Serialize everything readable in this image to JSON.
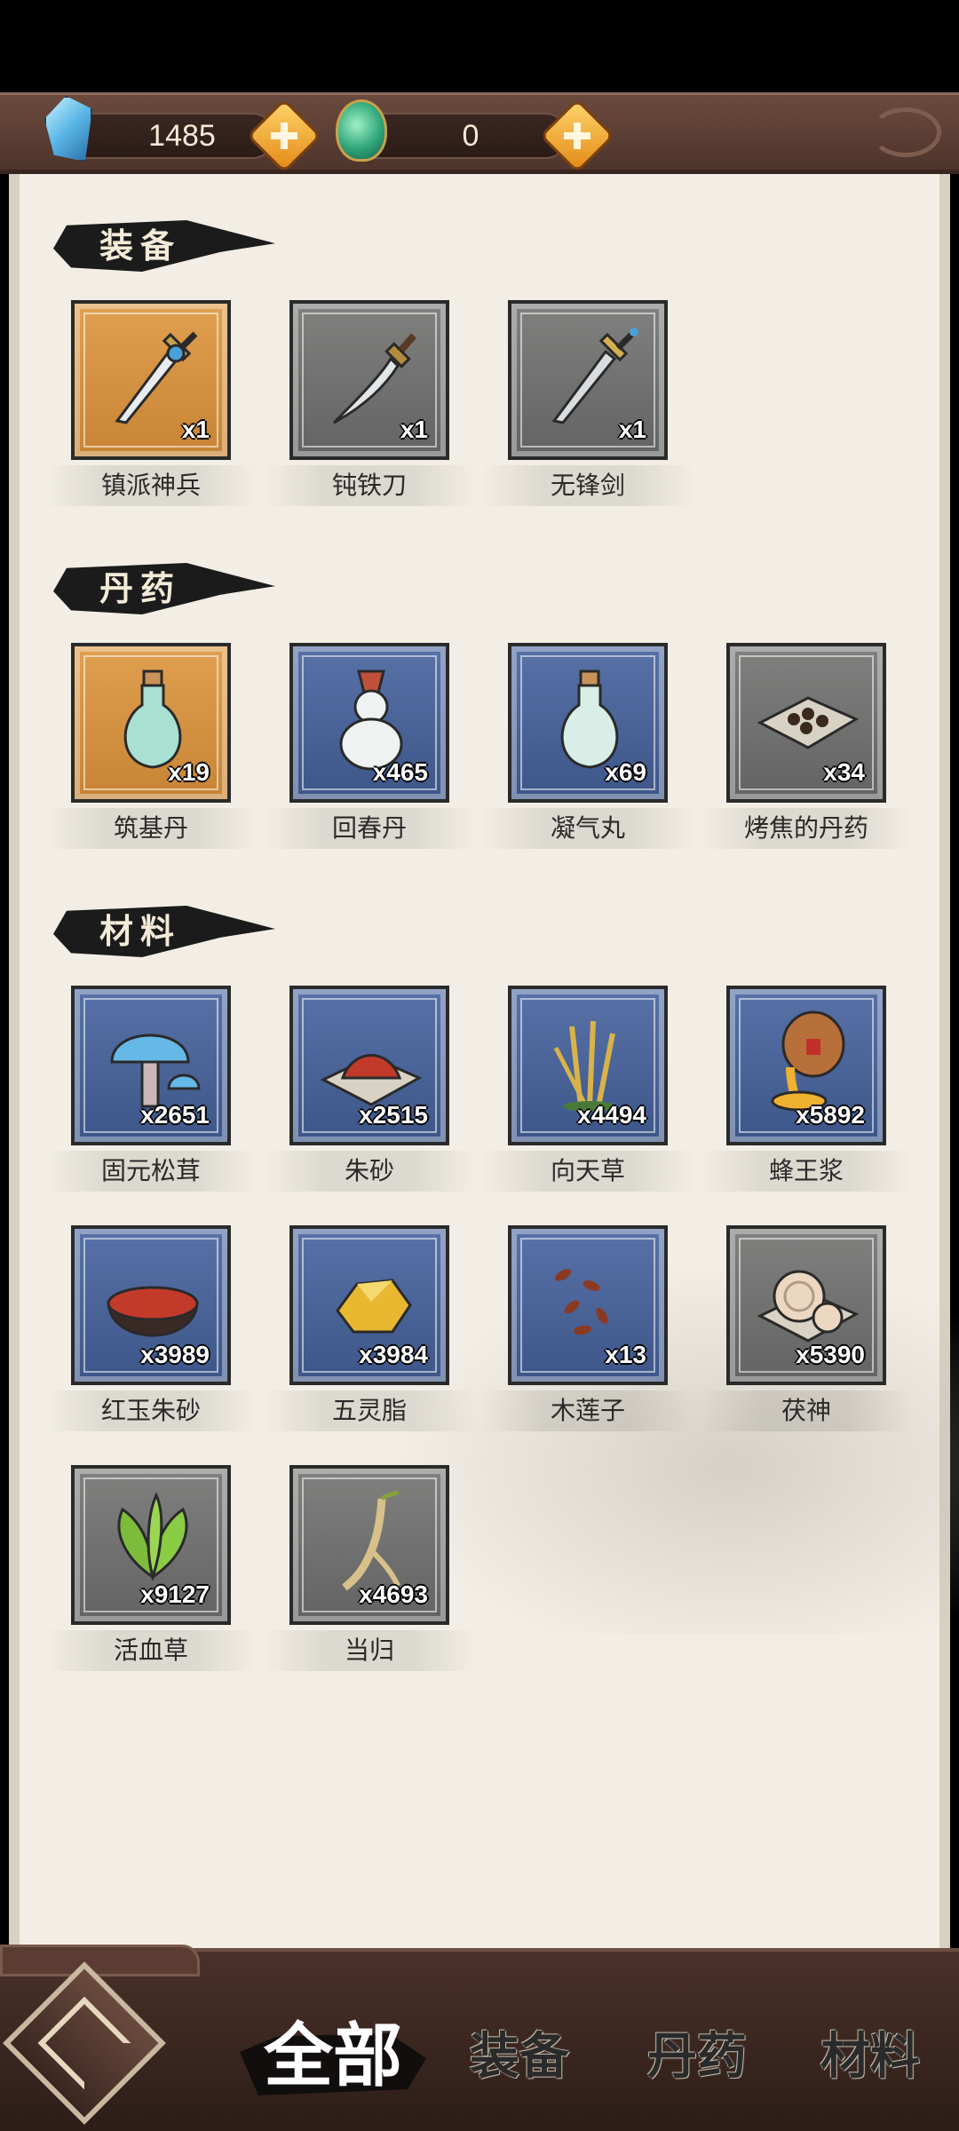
{
  "currency": {
    "crystals": "1485",
    "jade": "0"
  },
  "sections": [
    {
      "title": "装备",
      "items": [
        {
          "name": "镇派神兵",
          "qty": "x1",
          "rarity": "gold",
          "icon": "sword-icon"
        },
        {
          "name": "钝铁刀",
          "qty": "x1",
          "rarity": "gray",
          "icon": "saber-icon"
        },
        {
          "name": "无锋剑",
          "qty": "x1",
          "rarity": "gray",
          "icon": "sword-icon"
        }
      ]
    },
    {
      "title": "丹药",
      "items": [
        {
          "name": "筑基丹",
          "qty": "x19",
          "rarity": "gold",
          "icon": "potion-bottle-icon"
        },
        {
          "name": "回春丹",
          "qty": "x465",
          "rarity": "blue",
          "icon": "gourd-bottle-icon"
        },
        {
          "name": "凝气丸",
          "qty": "x69",
          "rarity": "blue",
          "icon": "potion-bottle-icon"
        },
        {
          "name": "烤焦的丹药",
          "qty": "x34",
          "rarity": "gray",
          "icon": "burnt-pills-icon"
        }
      ]
    },
    {
      "title": "材料",
      "items": [
        {
          "name": "固元松茸",
          "qty": "x2651",
          "rarity": "blue",
          "icon": "mushroom-icon"
        },
        {
          "name": "朱砂",
          "qty": "x2515",
          "rarity": "blue",
          "icon": "red-powder-icon"
        },
        {
          "name": "向天草",
          "qty": "x4494",
          "rarity": "blue",
          "icon": "golden-grass-icon"
        },
        {
          "name": "蜂王浆",
          "qty": "x5892",
          "rarity": "blue",
          "icon": "honey-jar-icon"
        },
        {
          "name": "红玉朱砂",
          "qty": "x3989",
          "rarity": "blue",
          "icon": "red-powder-bowl-icon"
        },
        {
          "name": "五灵脂",
          "qty": "x3984",
          "rarity": "blue",
          "icon": "amber-resin-icon"
        },
        {
          "name": "木莲子",
          "qty": "x13",
          "rarity": "blue",
          "icon": "seeds-icon"
        },
        {
          "name": "茯神",
          "qty": "x5390",
          "rarity": "gray",
          "icon": "fungus-slices-icon"
        },
        {
          "name": "活血草",
          "qty": "x9127",
          "rarity": "gray",
          "icon": "green-herb-icon"
        },
        {
          "name": "当归",
          "qty": "x4693",
          "rarity": "gray",
          "icon": "root-icon"
        }
      ]
    }
  ],
  "tabs": [
    "全部",
    "装备",
    "丹药",
    "材料"
  ],
  "active_tab": "全部",
  "colors": {
    "gold_tile": "#d2913f",
    "blue_tile": "#4a64a0",
    "gray_tile": "#717270",
    "paper": "#f2eee5",
    "frame": "#4e342b"
  }
}
